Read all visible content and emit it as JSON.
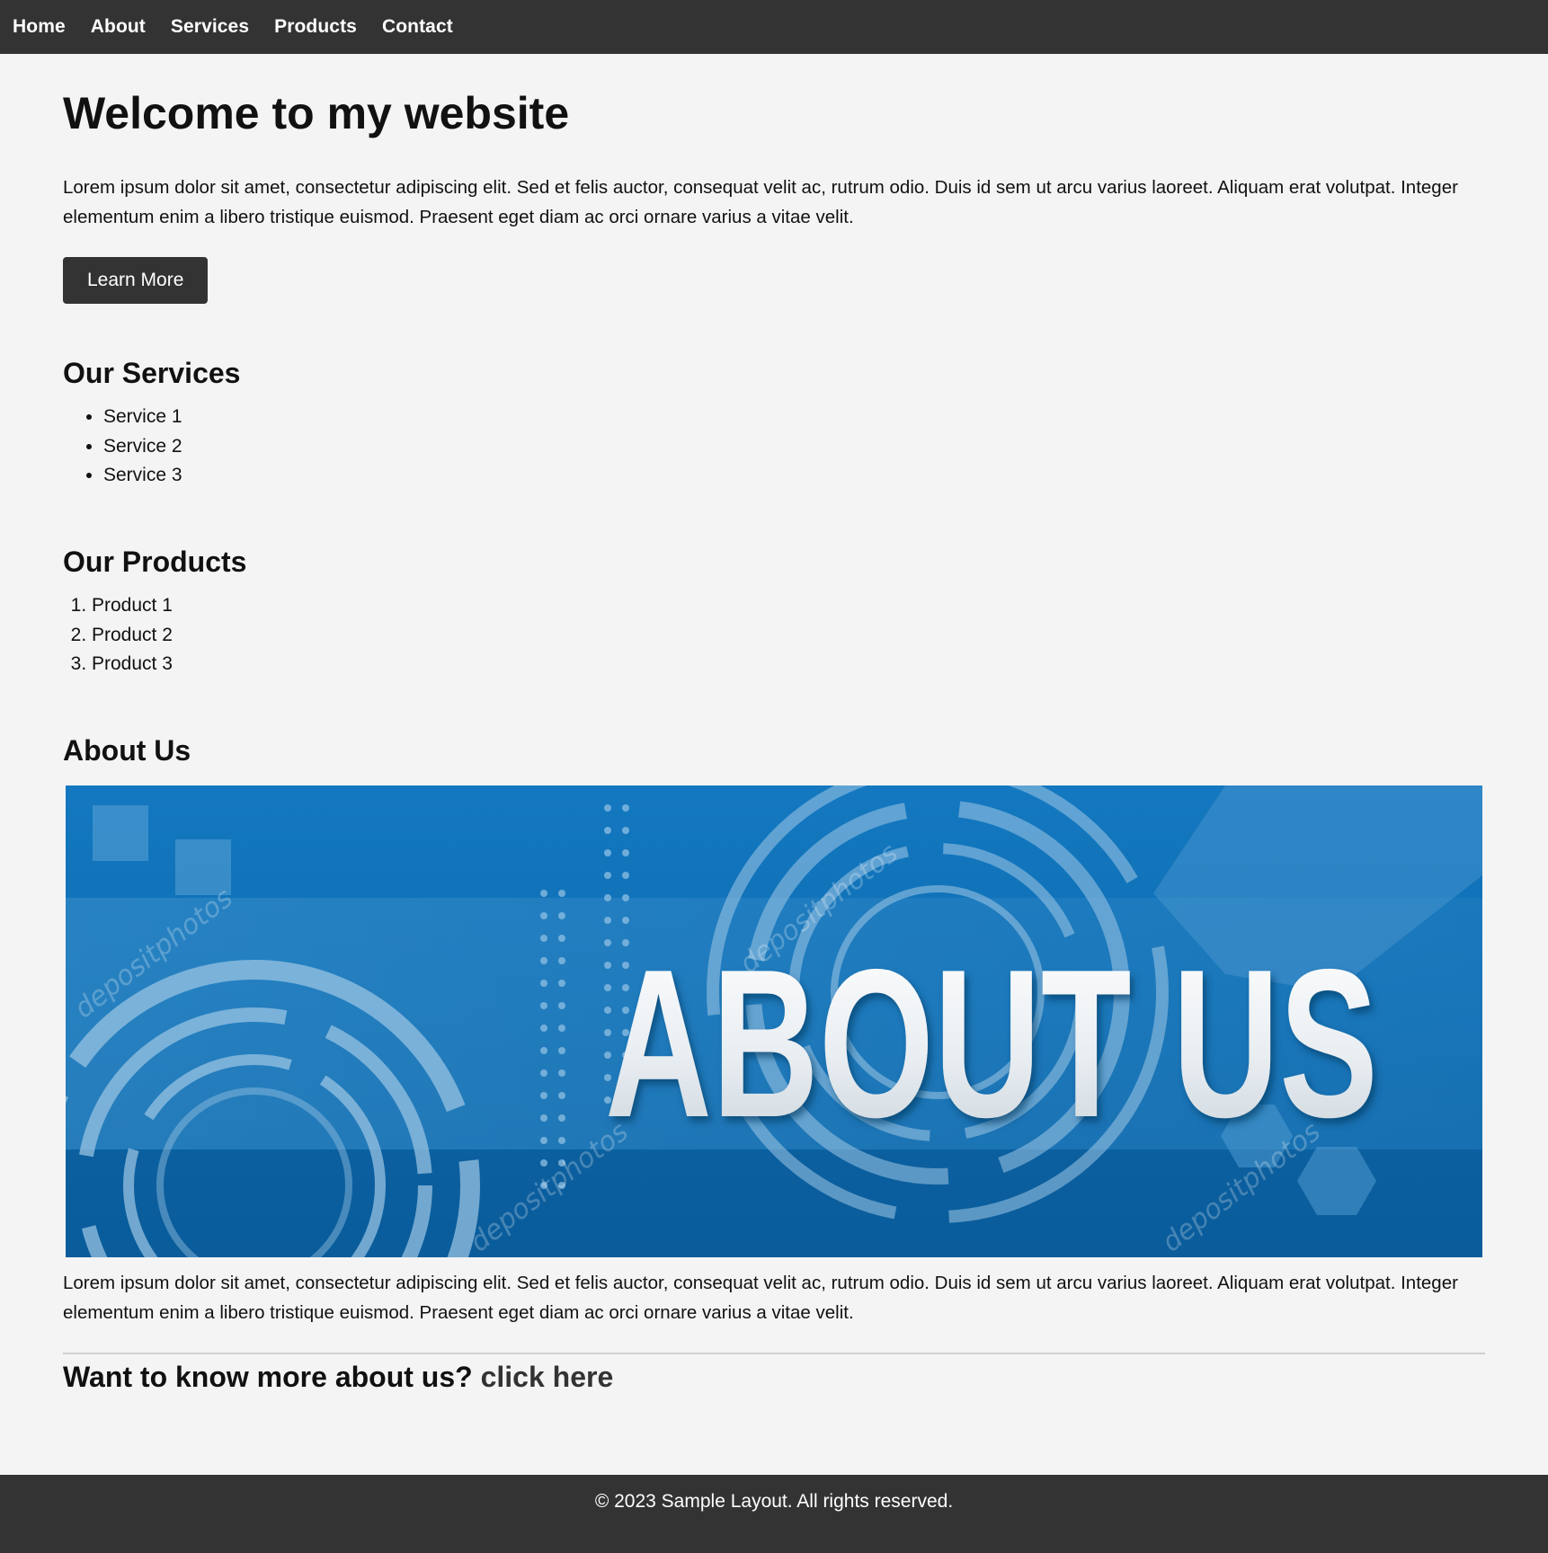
{
  "nav": {
    "items": [
      {
        "label": "Home"
      },
      {
        "label": "About"
      },
      {
        "label": "Services"
      },
      {
        "label": "Products"
      },
      {
        "label": "Contact"
      }
    ]
  },
  "hero": {
    "title": "Welcome to my website",
    "text": "Lorem ipsum dolor sit amet, consectetur adipiscing elit. Sed et felis auctor, consequat velit ac, rutrum odio. Duis id sem ut arcu varius laoreet. Aliquam erat volutpat. Integer elementum enim a libero tristique euismod. Praesent eget diam ac orci ornare varius a vitae velit.",
    "button_label": "Learn More"
  },
  "services": {
    "title": "Our Services",
    "items": [
      "Service 1",
      "Service 2",
      "Service 3"
    ]
  },
  "products": {
    "title": "Our Products",
    "items": [
      "Product 1",
      "Product 2",
      "Product 3"
    ]
  },
  "about": {
    "title": "About Us",
    "banner_text": "ABOUT US",
    "watermark_text": "depositphotos",
    "text": "Lorem ipsum dolor sit amet, consectetur adipiscing elit. Sed et felis auctor, consequat velit ac, rutrum odio. Duis id sem ut arcu varius laoreet. Aliquam erat volutpat. Integer elementum enim a libero tristique euismod. Praesent eget diam ac orci ornare varius a vitae velit.",
    "cta_text": "Want to know more about us?",
    "cta_link": "click here"
  },
  "footer": {
    "text": "© 2023 Sample Layout. All rights reserved."
  },
  "colors": {
    "nav_bg": "#333333",
    "page_bg": "#f4f4f4",
    "banner_blue": "#0e6fb4"
  }
}
